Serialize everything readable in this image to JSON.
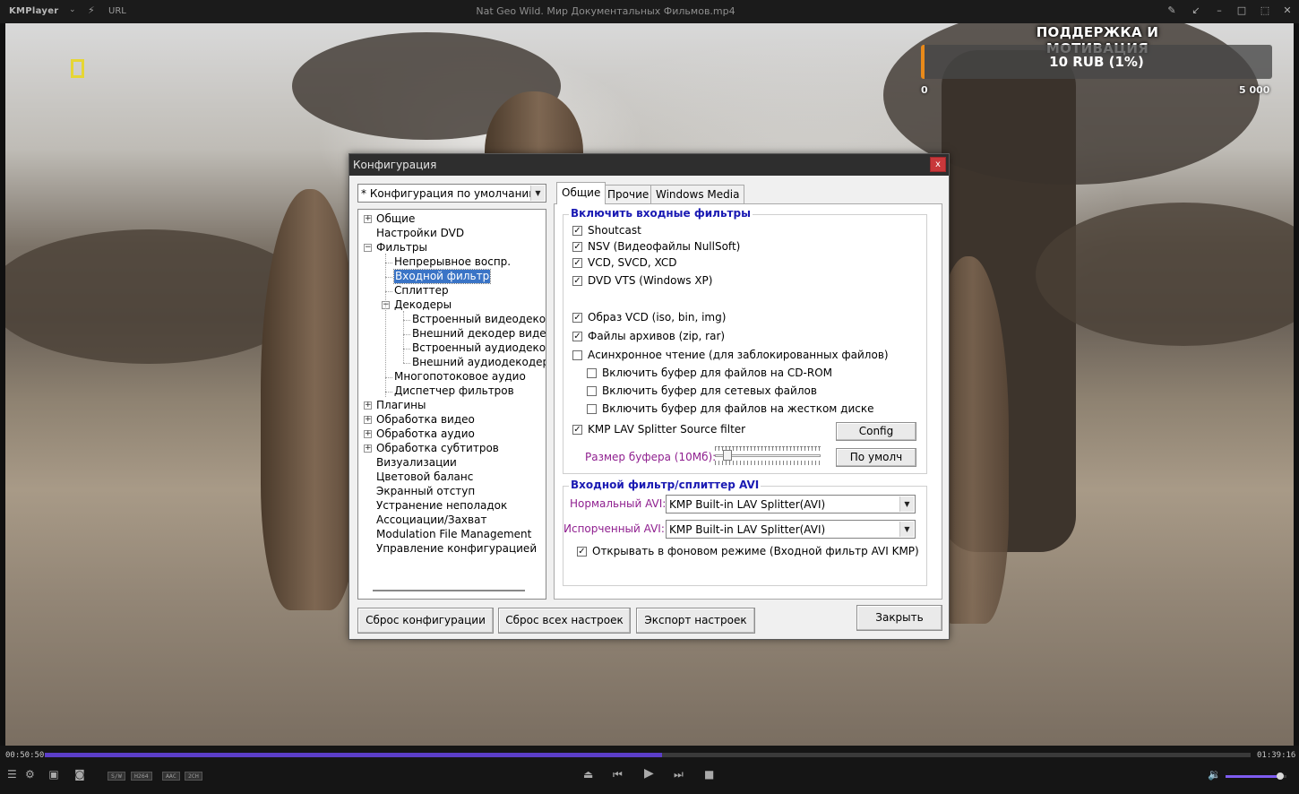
{
  "titlebar": {
    "app_name": "KMPlayer",
    "url_label": "URL",
    "file_title": "Nat Geo Wild. Мир Документальных Фильмов.mp4"
  },
  "overlay": {
    "donate_title": "ПОДДЕРЖКА И МОТИВАЦИЯ",
    "donate_amount": "10 RUB (1%)",
    "donate_progress": 0.01,
    "donate_min": "0",
    "donate_max": "5 000",
    "bar_color": "#e98a1a"
  },
  "dialog": {
    "title": "Конфигурация",
    "close_glyph": "x",
    "profile_combo": "* Конфигурация по умолчанию",
    "tree": [
      {
        "label": "Общие",
        "level": 0,
        "expander": "+"
      },
      {
        "label": "Настройки DVD",
        "level": 0,
        "expander": ""
      },
      {
        "label": "Фильтры",
        "level": 0,
        "expander": "−"
      },
      {
        "label": "Непрерывное воспр.",
        "level": 1,
        "expander": ""
      },
      {
        "label": "Входной фильтр",
        "level": 1,
        "expander": "",
        "selected": true
      },
      {
        "label": "Сплиттер",
        "level": 1,
        "expander": ""
      },
      {
        "label": "Декодеры",
        "level": 1,
        "expander": "−"
      },
      {
        "label": "Встроенный видеодекоде",
        "level": 2,
        "expander": ""
      },
      {
        "label": "Внешний декодер видео",
        "level": 2,
        "expander": ""
      },
      {
        "label": "Встроенный аудиодекоде",
        "level": 2,
        "expander": ""
      },
      {
        "label": "Внешний аудиодекодер",
        "level": 2,
        "expander": ""
      },
      {
        "label": "Многопотоковое аудио",
        "level": 1,
        "expander": ""
      },
      {
        "label": "Диспетчер фильтров",
        "level": 1,
        "expander": ""
      },
      {
        "label": "Плагины",
        "level": 0,
        "expander": "+"
      },
      {
        "label": "Обработка видео",
        "level": 0,
        "expander": "+"
      },
      {
        "label": "Обработка аудио",
        "level": 0,
        "expander": "+"
      },
      {
        "label": "Обработка субтитров",
        "level": 0,
        "expander": "+"
      },
      {
        "label": "Визуализации",
        "level": 0,
        "expander": ""
      },
      {
        "label": "Цветовой баланс",
        "level": 0,
        "expander": ""
      },
      {
        "label": "Экранный отступ",
        "level": 0,
        "expander": ""
      },
      {
        "label": "Устранение неполадок",
        "level": 0,
        "expander": ""
      },
      {
        "label": "Ассоциации/Захват",
        "level": 0,
        "expander": ""
      },
      {
        "label": "Modulation File Management",
        "level": 0,
        "expander": ""
      },
      {
        "label": "Управление конфигурацией",
        "level": 0,
        "expander": ""
      }
    ],
    "tabs": [
      "Общие",
      "Прочие",
      "Windows Media"
    ],
    "active_tab": 0,
    "group_input_title": "Включить входные фильтры",
    "checks": [
      {
        "label": "Shoutcast",
        "checked": true
      },
      {
        "label": "NSV (Видеофайлы NullSoft)",
        "checked": true
      },
      {
        "label": "VCD, SVCD, XCD",
        "checked": true
      },
      {
        "label": "DVD VTS (Windows XP)",
        "checked": true
      },
      {
        "label": "Образ VCD (iso, bin, img)",
        "checked": true
      },
      {
        "label": "Файлы архивов (zip, rar)",
        "checked": true
      },
      {
        "label": "Асинхронное чтение (для заблокированных файлов)",
        "checked": false
      },
      {
        "label": "Включить буфер для файлов на CD-ROM",
        "checked": false
      },
      {
        "label": "Включить буфер для сетевых файлов",
        "checked": false
      },
      {
        "label": "Включить буфер для файлов на жестком диске",
        "checked": false
      },
      {
        "label": "KMP LAV Splitter Source filter",
        "checked": true
      }
    ],
    "config_button": "Config",
    "buffer_label": "Размер буфера (10Мб):",
    "buffer_level": 0.08,
    "default_button": "По умолч",
    "group_avi_title": "Входной фильтр/сплиттер AVI",
    "normal_avi_label": "Нормальный AVI:",
    "normal_avi_value": "KMP Built-in LAV Splitter(AVI)",
    "broken_avi_label": "Испорченный AVI:",
    "broken_avi_value": "KMP Built-in LAV Splitter(AVI)",
    "background_check": {
      "label": "Открывать в фоновом режиме (Входной фильтр AVI KMP)",
      "checked": true
    },
    "buttons": {
      "reset_config": "Сброс конфигурации",
      "reset_all": "Сброс всех настроек",
      "export": "Экспорт настроек",
      "close": "Закрыть"
    }
  },
  "controls": {
    "time_elapsed": "00:50:50",
    "time_total": "01:39:16",
    "progress": 0.512,
    "badges": [
      "S/W",
      "H264",
      "AAC",
      "2CH"
    ],
    "volume": 0.9,
    "accent": "#5b3ec8"
  }
}
